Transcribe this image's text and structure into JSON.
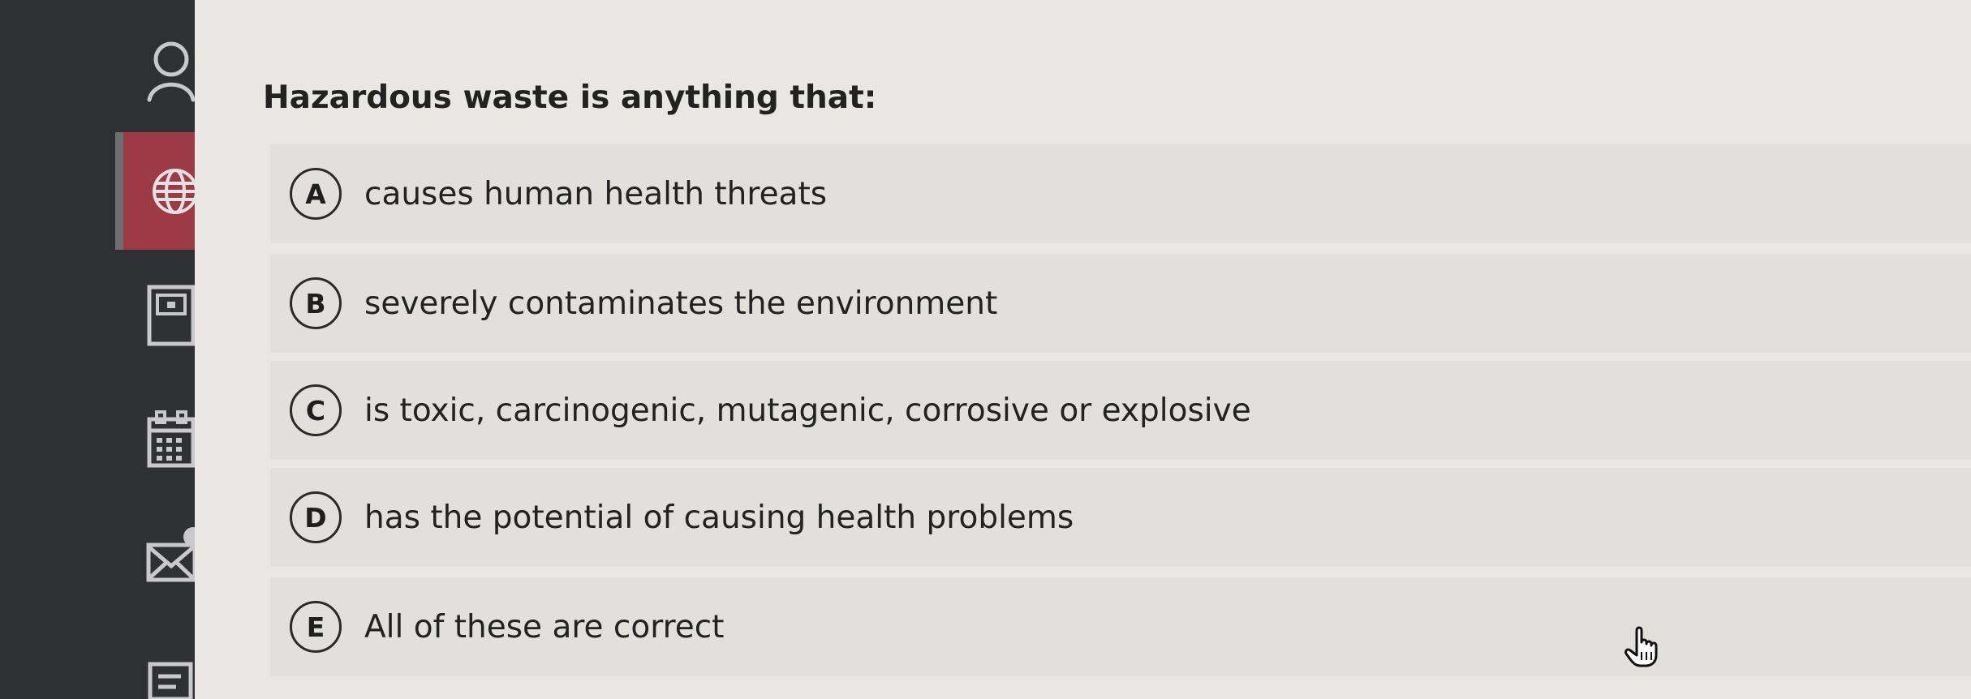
{
  "sidebar": {
    "icons": [
      "user-icon",
      "globe-icon",
      "calculator-icon",
      "calendar-icon",
      "mail-icon",
      "document-icon"
    ]
  },
  "question": {
    "text": "Hazardous waste is anything that:"
  },
  "options": [
    {
      "letter": "A",
      "text": "causes human health threats"
    },
    {
      "letter": "B",
      "text": "severely contaminates the environment"
    },
    {
      "letter": "C",
      "text": "is toxic, carcinogenic, mutagenic, corrosive or explosive"
    },
    {
      "letter": "D",
      "text": "has the potential of causing health problems"
    },
    {
      "letter": "E",
      "text": "All of these are correct"
    }
  ],
  "colors": {
    "sidebar": "#2f3033",
    "active": "#9c3b43",
    "background": "#e8e7e4",
    "option_background": "#e1e0dd"
  },
  "cursor": "hand-pointer-icon"
}
